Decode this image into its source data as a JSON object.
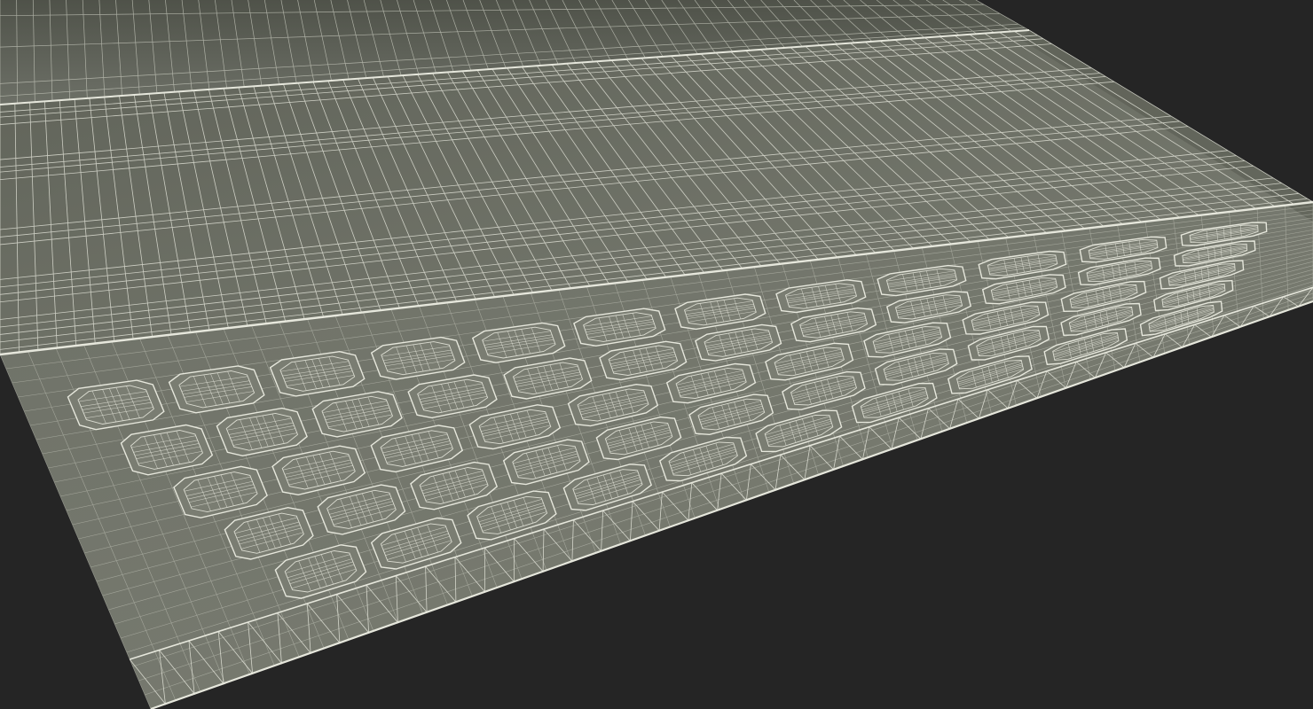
{
  "scene": {
    "subject": "keyboard-wireframe-render",
    "colors": {
      "background": "#252525",
      "surface": "#71746a",
      "surface_light": "#7a7d72",
      "surface_dark": "#5d6056",
      "wire": "#e6e7dc",
      "wire_dim": "#c9cbbf"
    },
    "keyboard": {
      "rows": 5,
      "keys_per_row": [
        12,
        12,
        11,
        11,
        10
      ],
      "key_style": "rounded-rectangle"
    }
  }
}
